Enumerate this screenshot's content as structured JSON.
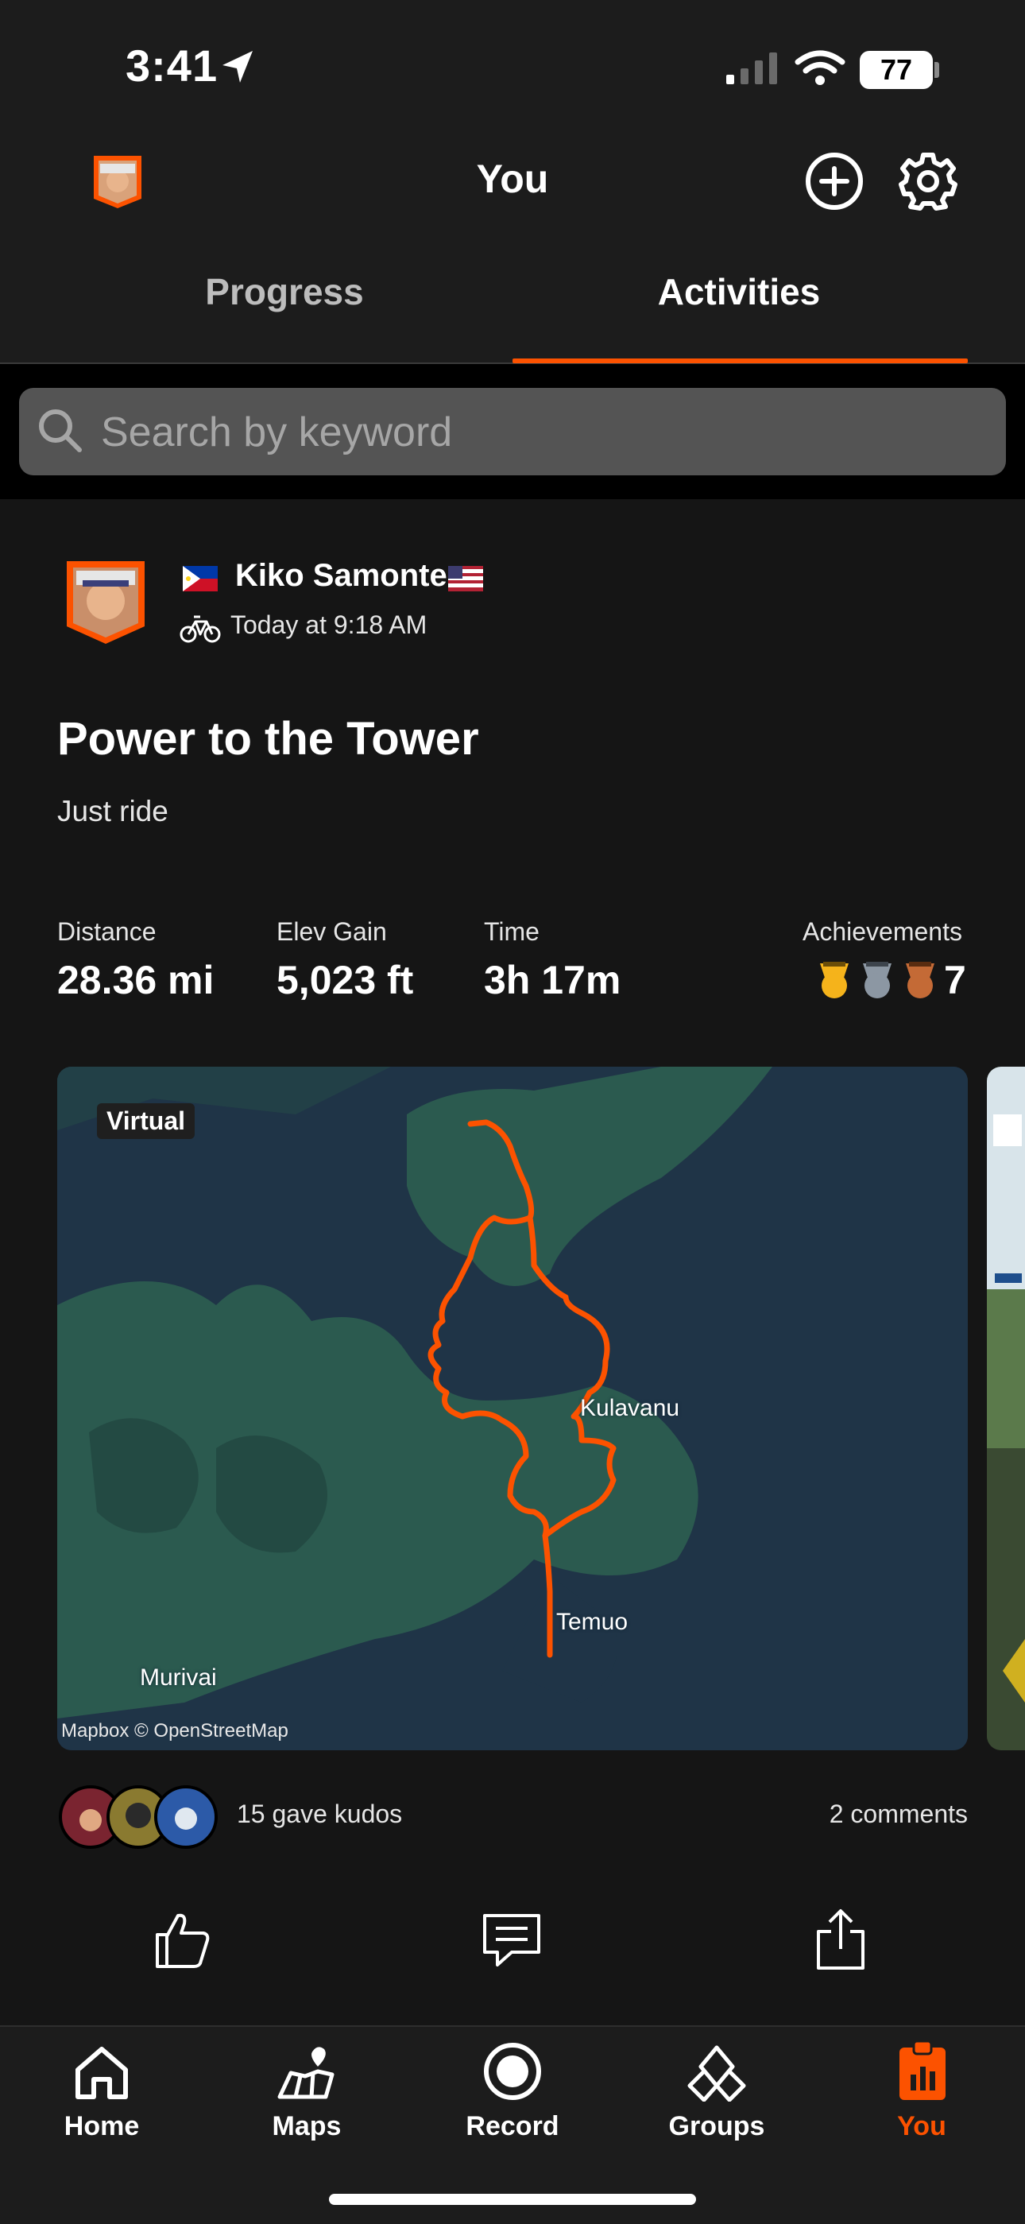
{
  "status_bar": {
    "time": "3:41",
    "battery": "77"
  },
  "header": {
    "title": "You"
  },
  "tabs": [
    {
      "label": "Progress"
    },
    {
      "label": "Activities"
    }
  ],
  "search": {
    "placeholder": "Search by keyword"
  },
  "activity": {
    "athlete_name": "Kiko Samonte",
    "time": "Today at 9:18 AM",
    "title": "Power to the Tower",
    "description": "Just ride",
    "stats": [
      {
        "label": "Distance",
        "value": "28.36 mi"
      },
      {
        "label": "Elev Gain",
        "value": "5,023 ft"
      },
      {
        "label": "Time",
        "value": "3h 17m"
      }
    ],
    "achievements": {
      "label": "Achievements",
      "count": "7"
    },
    "map": {
      "badge": "Virtual",
      "attribution": "Mapbox © OpenStreetMap",
      "places": {
        "kulavanu": "Kulavanu",
        "temuo": "Temuo",
        "murivai": "Murivai"
      },
      "route_color": "#fc5200"
    },
    "kudos": "15 gave kudos",
    "comments": "2 comments"
  },
  "nav": {
    "home": "Home",
    "maps": "Maps",
    "record": "Record",
    "groups": "Groups",
    "you": "You",
    "active_color": "#fc5200"
  }
}
